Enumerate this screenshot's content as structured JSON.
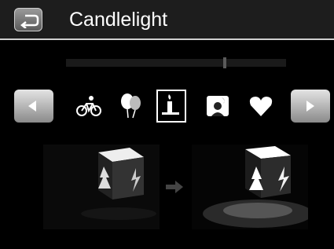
{
  "header": {
    "title": "Candlelight",
    "back_icon": "back-arrow-icon"
  },
  "level_slider": {
    "value": 0.72
  },
  "nav": {
    "prev_icon": "left-arrow-icon",
    "next_icon": "right-arrow-icon"
  },
  "scenes": [
    {
      "icon": "bicycle-icon",
      "selected": false
    },
    {
      "icon": "balloons-icon",
      "selected": false
    },
    {
      "icon": "candle-icon",
      "selected": true
    },
    {
      "icon": "night-portrait-icon",
      "selected": false
    },
    {
      "icon": "heart-icon",
      "selected": false
    }
  ],
  "preview": {
    "before_image": "dim-lantern-photo",
    "after_image": "bright-lantern-photo",
    "arrow_icon": "transition-arrow-icon"
  }
}
